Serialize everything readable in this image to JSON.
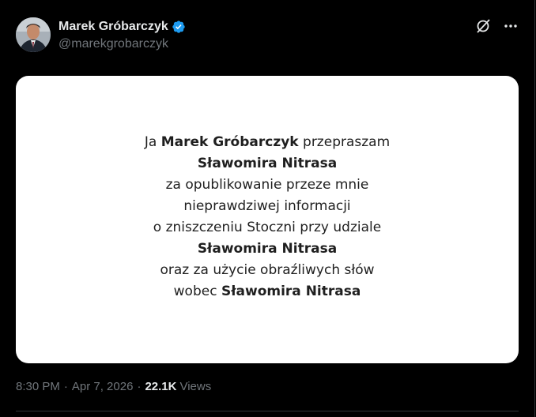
{
  "author": {
    "display_name": "Marek Gróbarczyk",
    "handle": "@marekgrobarczyk",
    "verified": true,
    "verified_color": "#1d9bf0"
  },
  "header_icons": {
    "grok": "grok-icon",
    "more": "more-icon"
  },
  "statement": {
    "lines": [
      {
        "before": "Ja ",
        "bold": "Marek Gróbarczyk",
        "after": " przepraszam"
      },
      {
        "before": "",
        "bold": "Sławomira Nitrasa",
        "after": ""
      },
      {
        "before": "za opublikowanie przeze mnie",
        "bold": "",
        "after": ""
      },
      {
        "before": "nieprawdziwej informacji",
        "bold": "",
        "after": ""
      },
      {
        "before": "o zniszczeniu Stoczni przy udziale",
        "bold": "",
        "after": ""
      },
      {
        "before": "",
        "bold": "Sławomira Nitrasa",
        "after": ""
      },
      {
        "before": "oraz za użycie obraźliwych słów",
        "bold": "",
        "after": ""
      },
      {
        "before": "wobec ",
        "bold": "Sławomira Nitrasa",
        "after": ""
      }
    ]
  },
  "meta": {
    "time": "8:30 PM",
    "separator": "·",
    "date": "Apr 7, 2026",
    "views_count": "22.1K",
    "views_label": "Views"
  },
  "colors": {
    "background": "#000000",
    "primary_text": "#e7e9ea",
    "secondary_text": "#71767b",
    "card_background": "#ffffff"
  }
}
